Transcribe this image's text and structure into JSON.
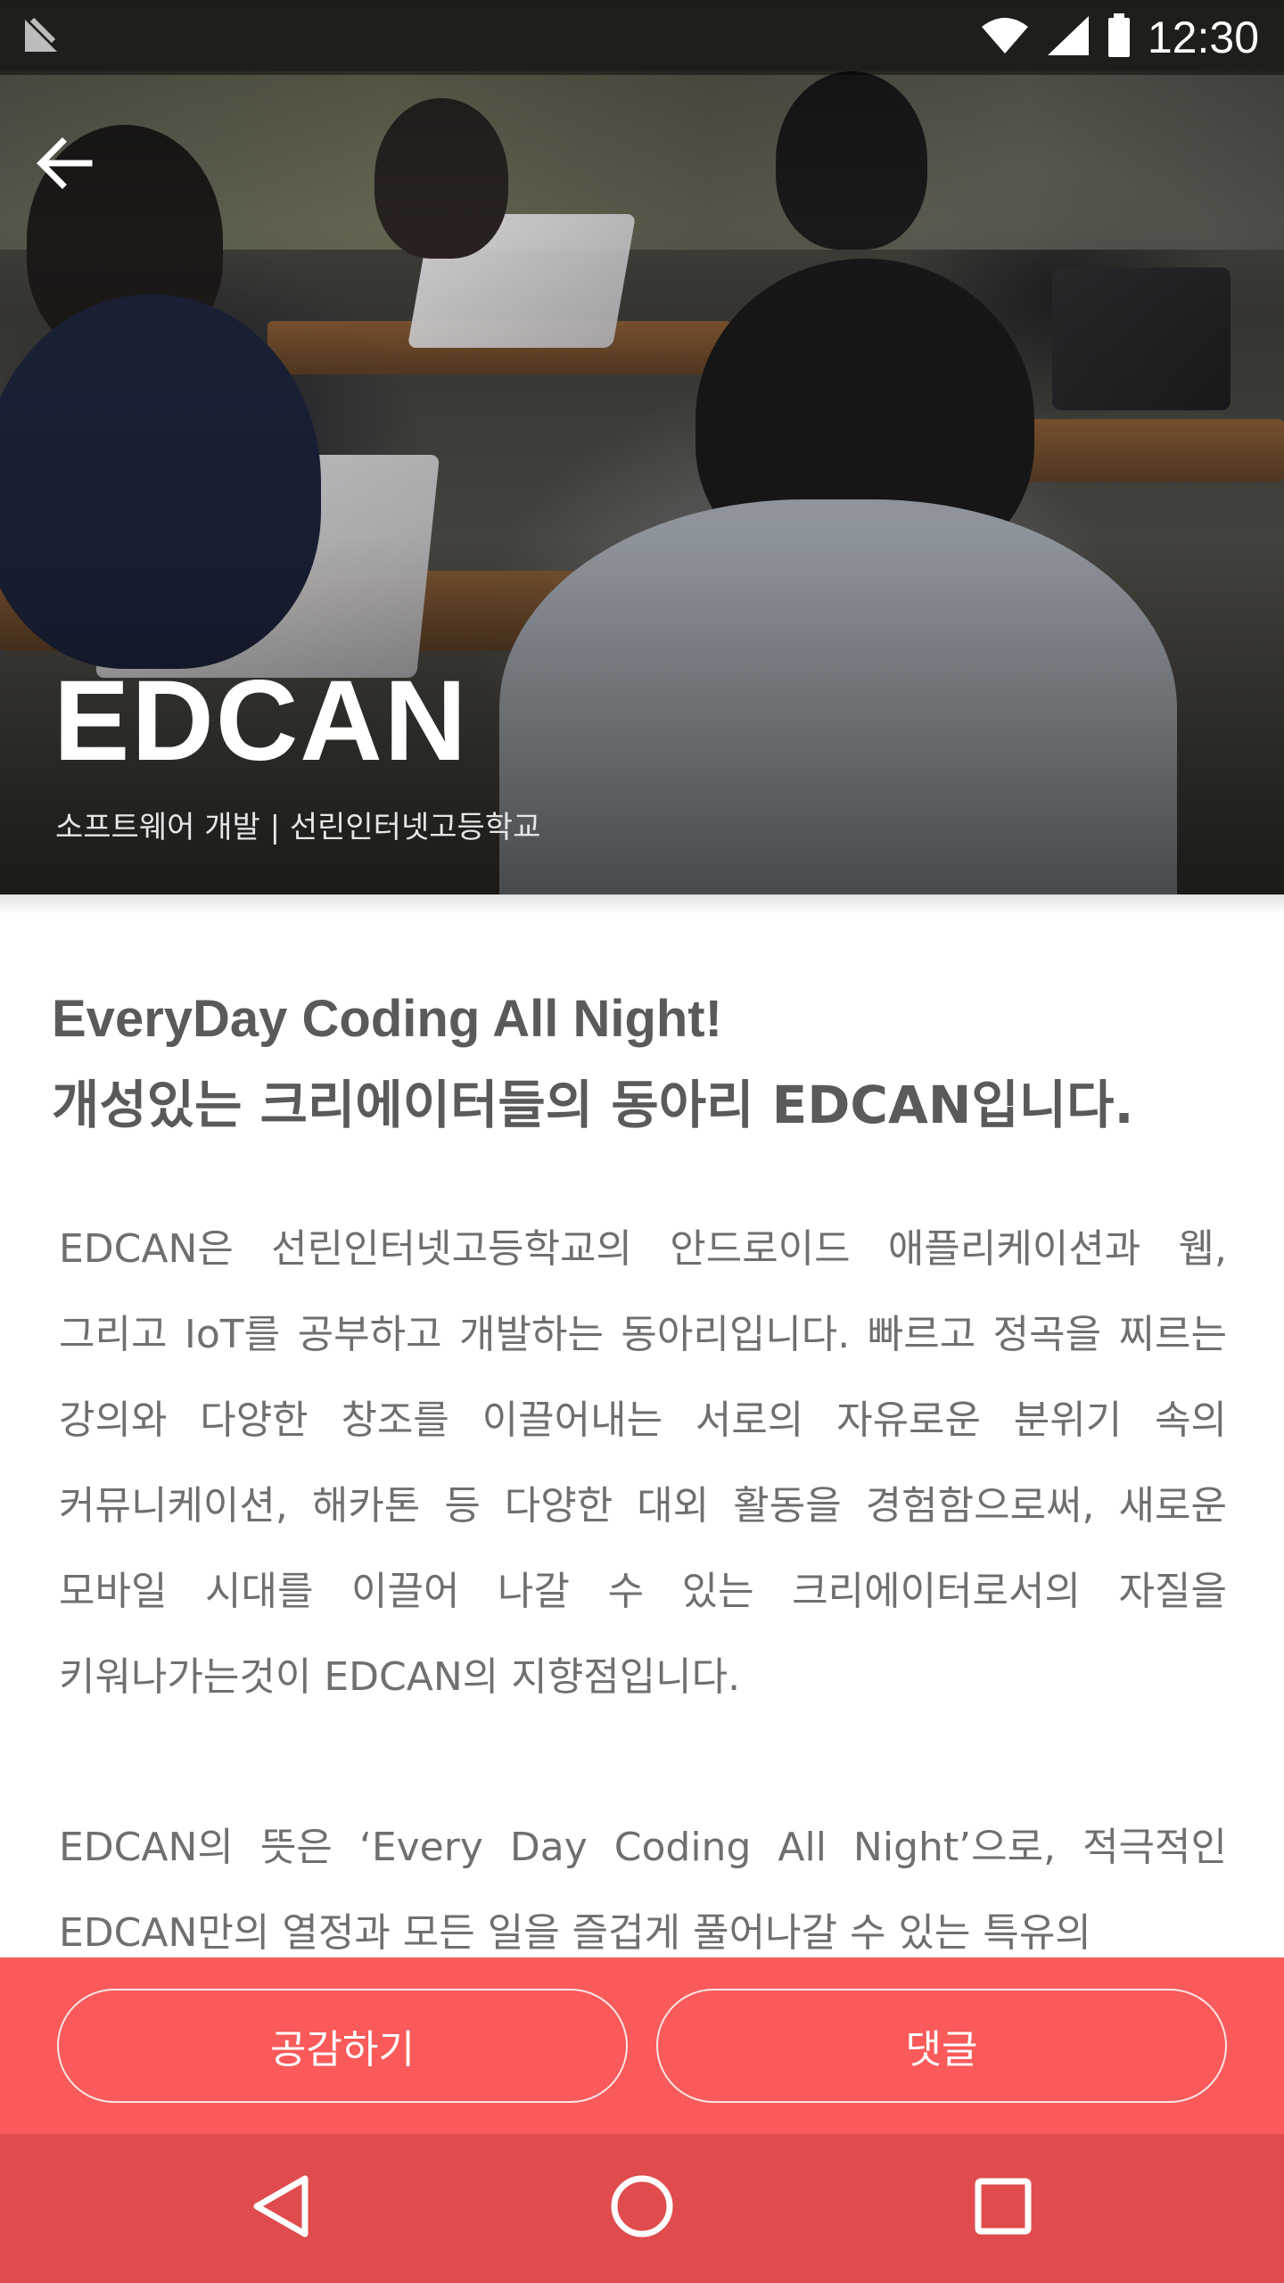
{
  "status_bar": {
    "time": "12:30",
    "icons": [
      "notification-icon",
      "wifi-icon",
      "signal-icon",
      "battery-icon"
    ]
  },
  "hero": {
    "title": "EDCAN",
    "subtitle": "소프트웨어 개발 | 선린인터넷고등학교",
    "back_icon": "arrow-back-icon"
  },
  "content": {
    "headline_line1": "EveryDay Coding All Night!",
    "headline_line2": "개성있는 크리에이터들의 동아리 EDCAN입니다.",
    "paragraph1": "EDCAN은 선린인터넷고등학교의 안드로이드 애플리케이션과 웹, 그리고 IoT를 공부하고 개발하는 동아리입니다. 빠르고 정곡을 찌르는 강의와 다양한 창조를 이끌어내는 서로의 자유로운 분위기 속의 커뮤니케이션, 해카톤 등 다양한 대외 활동을 경험함으로써, 새로운 모바일 시대를 이끌어 나갈 수 있는 크리에이터로서의 자질을 키워나가는것이 EDCAN의 지향점입니다.",
    "paragraph2": "EDCAN의 뜻은 ‘Every Day Coding All Night’으로, 적극적인 EDCAN만의 열정과 모든 일을 즐겁게 풀어나갈 수 있는 특유의"
  },
  "actions": {
    "like_label": "공감하기",
    "comment_label": "댓글"
  },
  "nav_bar": {
    "icons": [
      "nav-back-icon",
      "nav-home-icon",
      "nav-recents-icon"
    ]
  },
  "colors": {
    "accent": "#fa5a5a",
    "nav_bar": "#e04c4d",
    "headline_text": "#5a5a5a",
    "body_text": "#6f6f6f"
  }
}
